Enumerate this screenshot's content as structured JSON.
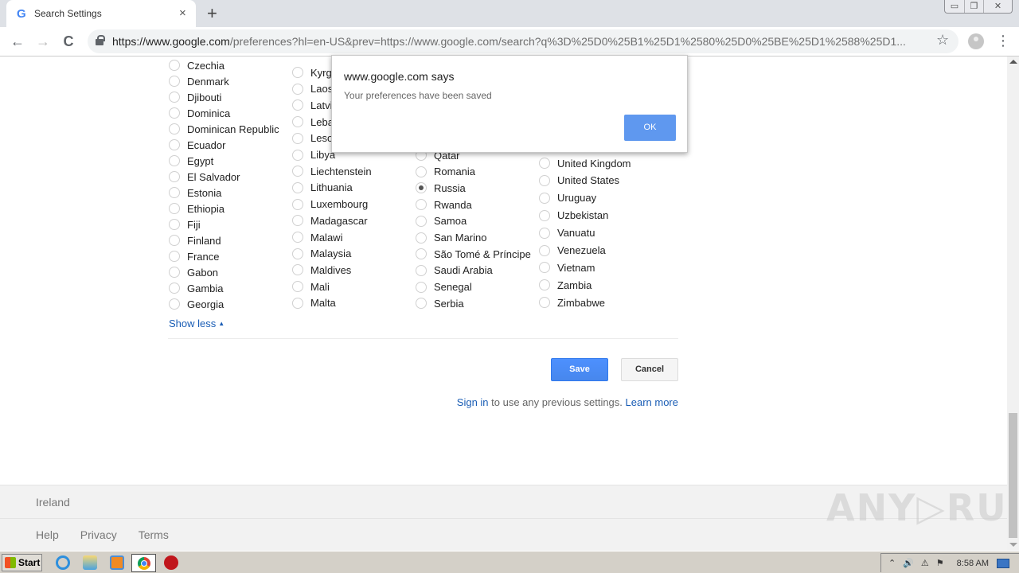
{
  "browser": {
    "tab_title": "Search Settings",
    "tab_close_glyph": "×",
    "new_tab_glyph": "+",
    "window_controls": [
      "▭",
      "❐",
      "✕"
    ],
    "url_host": "https://www.google.com",
    "url_rest": "/preferences?hl=en-US&prev=https://www.google.com/search?q%3D%25D0%25B1%25D1%2580%25D0%25BE%25D1%2588%25D1...",
    "back_glyph": "←",
    "forward_glyph": "→",
    "reload_glyph": "C",
    "star_glyph": "☆",
    "menu_glyph": "⋮"
  },
  "regions": {
    "columns": [
      {
        "items": [
          {
            "label": "Czechia",
            "checked": false
          },
          {
            "label": "Denmark",
            "checked": false
          },
          {
            "label": "Djibouti",
            "checked": false
          },
          {
            "label": "Dominica",
            "checked": false
          },
          {
            "label": "Dominican Republic",
            "checked": false
          },
          {
            "label": "Ecuador",
            "checked": false
          },
          {
            "label": "Egypt",
            "checked": false
          },
          {
            "label": "El Salvador",
            "checked": false
          },
          {
            "label": "Estonia",
            "checked": false
          },
          {
            "label": "Ethiopia",
            "checked": false
          },
          {
            "label": "Fiji",
            "checked": false
          },
          {
            "label": "Finland",
            "checked": false
          },
          {
            "label": "France",
            "checked": false
          },
          {
            "label": "Gabon",
            "checked": false
          },
          {
            "label": "Gambia",
            "checked": false
          },
          {
            "label": "Georgia",
            "checked": false
          }
        ]
      },
      {
        "items": [
          {
            "label": "Kyrg",
            "checked": false
          },
          {
            "label": "Laos",
            "checked": false
          },
          {
            "label": "Latvi",
            "checked": false
          },
          {
            "label": "Leba",
            "checked": false
          },
          {
            "label": "Leso",
            "checked": false
          },
          {
            "label": "Libya",
            "checked": false
          },
          {
            "label": "Liechtenstein",
            "checked": false
          },
          {
            "label": "Lithuania",
            "checked": false
          },
          {
            "label": "Luxembourg",
            "checked": false
          },
          {
            "label": "Madagascar",
            "checked": false
          },
          {
            "label": "Malawi",
            "checked": false
          },
          {
            "label": "Malaysia",
            "checked": false
          },
          {
            "label": "Maldives",
            "checked": false
          },
          {
            "label": "Mali",
            "checked": false
          },
          {
            "label": "Malta",
            "checked": false
          }
        ]
      },
      {
        "items": [
          {
            "label": "Qatar",
            "checked": false
          },
          {
            "label": "Romania",
            "checked": false
          },
          {
            "label": "Russia",
            "checked": true
          },
          {
            "label": "Rwanda",
            "checked": false
          },
          {
            "label": "Samoa",
            "checked": false
          },
          {
            "label": "San Marino",
            "checked": false
          },
          {
            "label": "São Tomé & Príncipe",
            "checked": false
          },
          {
            "label": "Saudi Arabia",
            "checked": false
          },
          {
            "label": "Senegal",
            "checked": false
          },
          {
            "label": "Serbia",
            "checked": false
          }
        ]
      },
      {
        "items": [
          {
            "label": "United Kingdom",
            "checked": false
          },
          {
            "label": "United States",
            "checked": false
          },
          {
            "label": "Uruguay",
            "checked": false
          },
          {
            "label": "Uzbekistan",
            "checked": false
          },
          {
            "label": "Vanuatu",
            "checked": false
          },
          {
            "label": "Venezuela",
            "checked": false
          },
          {
            "label": "Vietnam",
            "checked": false
          },
          {
            "label": "Zambia",
            "checked": false
          },
          {
            "label": "Zimbabwe",
            "checked": false
          }
        ]
      }
    ],
    "show_less_label": "Show less",
    "show_less_caret": "▲"
  },
  "actions": {
    "save_label": "Save",
    "cancel_label": "Cancel",
    "sign_in_link": "Sign in",
    "sign_in_text": " to use any previous settings. ",
    "learn_more_link": "Learn more"
  },
  "footer": {
    "country": "Ireland",
    "links": [
      "Help",
      "Privacy",
      "Terms"
    ]
  },
  "dialog": {
    "title": "www.google.com says",
    "message": "Your preferences have been saved",
    "ok_label": "OK"
  },
  "watermark": "ANY▷RUN",
  "taskbar": {
    "start_label": "Start",
    "clock": "8:58 AM",
    "tray_icons": [
      "⌃",
      "🔊",
      "⚠",
      "⚑"
    ]
  }
}
